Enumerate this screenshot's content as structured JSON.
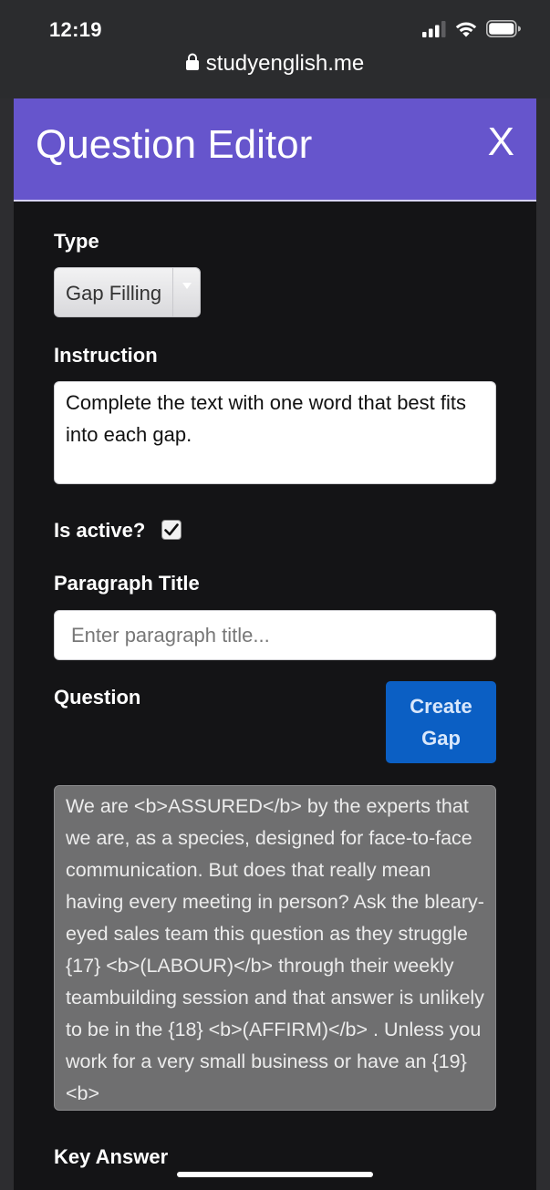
{
  "status_bar": {
    "time": "12:19",
    "icons": [
      "cellular-signal-icon",
      "wifi-icon",
      "battery-icon"
    ]
  },
  "browser": {
    "url": "studyenglish.me",
    "lock_icon": "lock-icon"
  },
  "modal": {
    "title": "Question Editor",
    "close_label": "X",
    "header_color": "#6655cc"
  },
  "form": {
    "type_label": "Type",
    "type_value": "Gap Filling",
    "instruction_label": "Instruction",
    "instruction_value": "Complete the text with one word that best fits into each gap.",
    "active_label": "Is active?",
    "active_checked": true,
    "paragraph_title_label": "Paragraph Title",
    "paragraph_title_placeholder": "Enter paragraph title...",
    "question_label": "Question",
    "create_gap_label": "Create Gap",
    "create_gap_color": "#0b5fc4",
    "question_text": "We are <b>ASSURED</b> by the experts that we are, as a species, designed for face-to-face communication. But does that really mean having every meeting in person? Ask the bleary-eyed sales team this question as they struggle {17} <b>(LABOUR)</b> through their weekly teambuilding session and that answer is unlikely to be in the {18} <b>(AFFIRM)</b> . Unless you work for a very small business or have an {19} <b>",
    "key_answer_label": "Key Answer"
  }
}
